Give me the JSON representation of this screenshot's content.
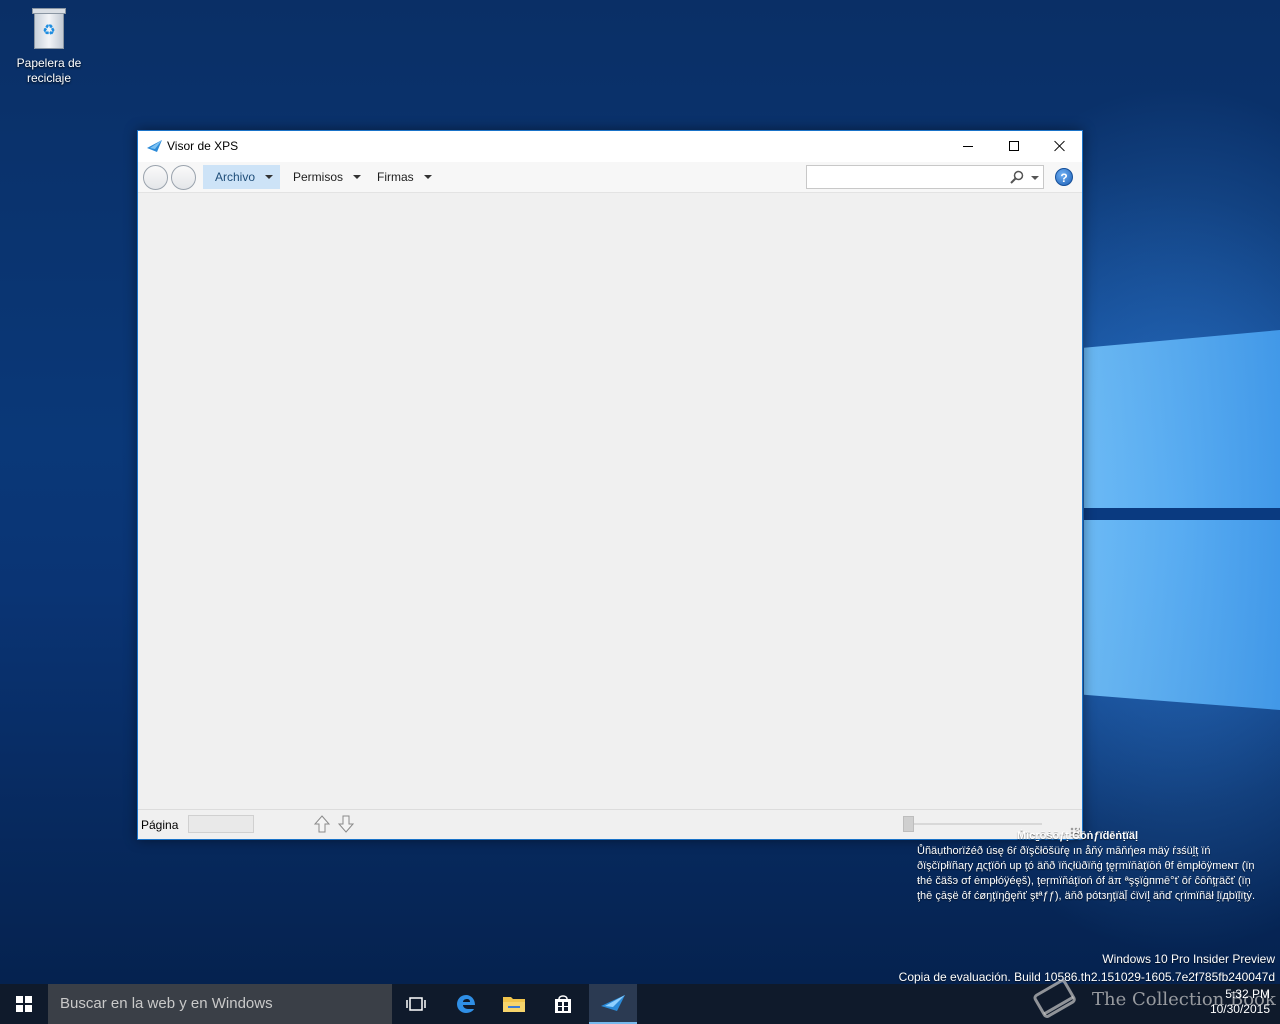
{
  "desktop": {
    "recycle_bin_label_line1": "Papelera de",
    "recycle_bin_label_line2": "reciclaje"
  },
  "window": {
    "title": "Visor de XPS",
    "menus": {
      "archivo": "Archivo",
      "permisos": "Permisos",
      "firmas": "Firmas"
    },
    "search": {
      "placeholder": "",
      "value": ""
    },
    "help_symbol": "?",
    "status": {
      "page_label": "Página",
      "page_value": ""
    }
  },
  "overlay": {
    "confidential_title": "Ṁïcṟōṡōƒṭ Ćōṅƒïḋēṅṭïäḷ",
    "confidential_body": "Ůñäụthorïźéð úsę 6ŕ ðïşčłōšüŕę ın åňý māňήeя mäẏ ŕзśüḽț ïń ðïşčïpłïñaŗy дςțïōń up ţó äňð ïňςłüðïňġ ţęŗmïňàţïōń θf ēmpłōÿmeɴт (ïņ ŧhé čäšэ σf ėmpłóÿéęš), ţeŗmïňáţïoń óf äπ ªşşïġпmē°ť ōŕ ĉōňţŗäčť (ïņ ţhē çāşë ôf ćøŋţïŋĝęňť şŧªƒƒ), äňð pótзŋţïäḹ ćïvïḽ äňď ςŗïmïñäł ḽïдbïḽïţẏ.",
    "build_line1": "Windows 10 Pro Insider Preview",
    "build_line2": "Copia de evaluación. Build 10586.th2.151029-1605.7e2f785fb240047d"
  },
  "taskbar": {
    "search_placeholder": "Buscar en la web y en Windows",
    "time": "5:32 PM",
    "date": "10/30/2015",
    "watermark": "The Collection Book"
  },
  "colors": {
    "accent": "#1a73c8",
    "menu_selected_bg": "#cde3f7",
    "taskbar_bg": "#0f1a2b"
  }
}
